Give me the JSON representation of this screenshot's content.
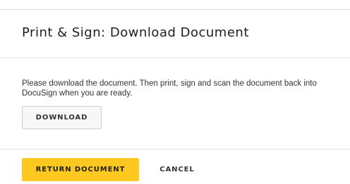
{
  "dialog": {
    "title": "Print & Sign: Download Document",
    "message": "Please download the document. Then print, sign and scan the document back into DocuSign when you are ready.",
    "download_label": "DOWNLOAD",
    "return_label": "RETURN DOCUMENT",
    "cancel_label": "CANCEL"
  },
  "colors": {
    "primary_button": "#ffc820",
    "secondary_button": "#f7f7f7",
    "divider": "#e2e2e2",
    "text": "#1e1e1e"
  }
}
